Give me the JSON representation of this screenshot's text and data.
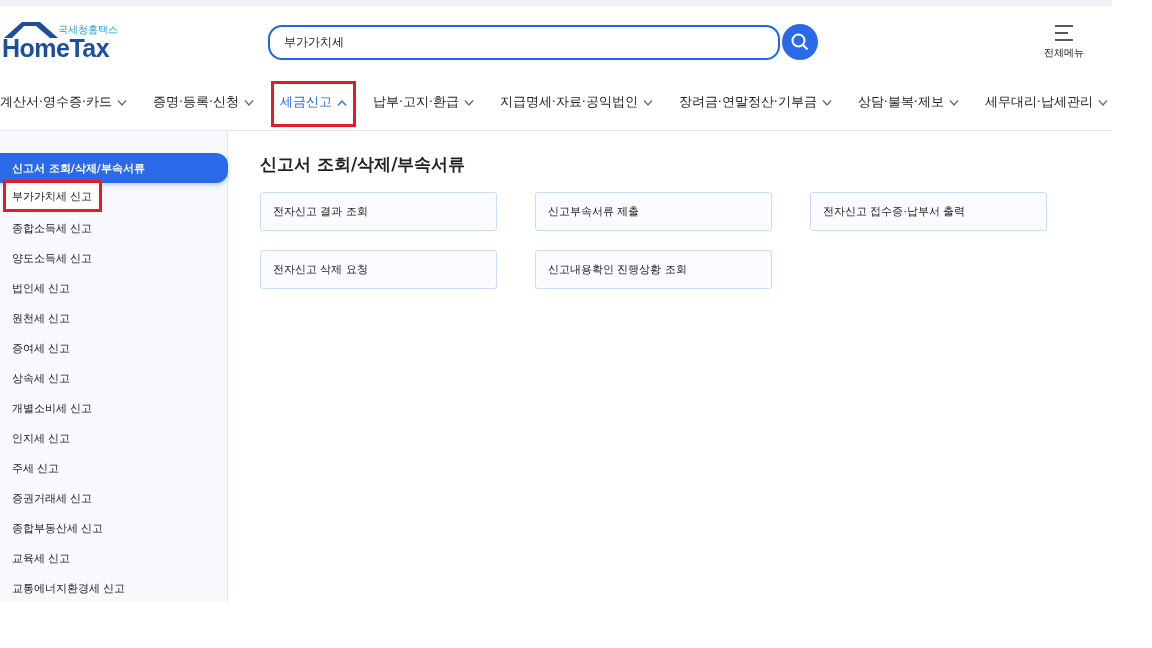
{
  "logo": {
    "subtitle": "국세청홈택스",
    "name": "HomeTax"
  },
  "search": {
    "value": "부가가치세"
  },
  "all_menu": {
    "label": "전체메뉴"
  },
  "nav": [
    {
      "label": "계산서·영수증·카드",
      "selected": false,
      "expanded": false,
      "highlighted": false
    },
    {
      "label": "증명·등록·신청",
      "selected": false,
      "expanded": false,
      "highlighted": false
    },
    {
      "label": "세금신고",
      "selected": true,
      "expanded": true,
      "highlighted": true
    },
    {
      "label": "납부·고지·환급",
      "selected": false,
      "expanded": false,
      "highlighted": false
    },
    {
      "label": "지급명세·자료·공익법인",
      "selected": false,
      "expanded": false,
      "highlighted": false
    },
    {
      "label": "장려금·연말정산·기부금",
      "selected": false,
      "expanded": false,
      "highlighted": false
    },
    {
      "label": "상담·불복·제보",
      "selected": false,
      "expanded": false,
      "highlighted": false
    },
    {
      "label": "세무대리·납세관리",
      "selected": false,
      "expanded": false,
      "highlighted": false
    }
  ],
  "sidebar": {
    "items": [
      {
        "label": "신고서 조회/삭제/부속서류",
        "selected": true,
        "highlighted": false
      },
      {
        "label": "부가가치세 신고",
        "selected": false,
        "highlighted": true
      },
      {
        "label": "종합소득세 신고",
        "selected": false,
        "highlighted": false
      },
      {
        "label": "양도소득세 신고",
        "selected": false,
        "highlighted": false
      },
      {
        "label": "법인세 신고",
        "selected": false,
        "highlighted": false
      },
      {
        "label": "원천세 신고",
        "selected": false,
        "highlighted": false
      },
      {
        "label": "증여세 신고",
        "selected": false,
        "highlighted": false
      },
      {
        "label": "상속세 신고",
        "selected": false,
        "highlighted": false
      },
      {
        "label": "개별소비세 신고",
        "selected": false,
        "highlighted": false
      },
      {
        "label": "인지세 신고",
        "selected": false,
        "highlighted": false
      },
      {
        "label": "주세 신고",
        "selected": false,
        "highlighted": false
      },
      {
        "label": "증권거래세 신고",
        "selected": false,
        "highlighted": false
      },
      {
        "label": "종합부동산세 신고",
        "selected": false,
        "highlighted": false
      },
      {
        "label": "교육세 신고",
        "selected": false,
        "highlighted": false
      },
      {
        "label": "교통에너지환경세 신고",
        "selected": false,
        "highlighted": false
      }
    ]
  },
  "content": {
    "title": "신고서 조회/삭제/부속서류",
    "links": [
      "전자신고 결과 조회",
      "신고부속서류 제출",
      "전자신고 접수증·납부서 출력",
      "전자신고 삭제 요청",
      "신고내용확인 진행상황 조회"
    ]
  }
}
